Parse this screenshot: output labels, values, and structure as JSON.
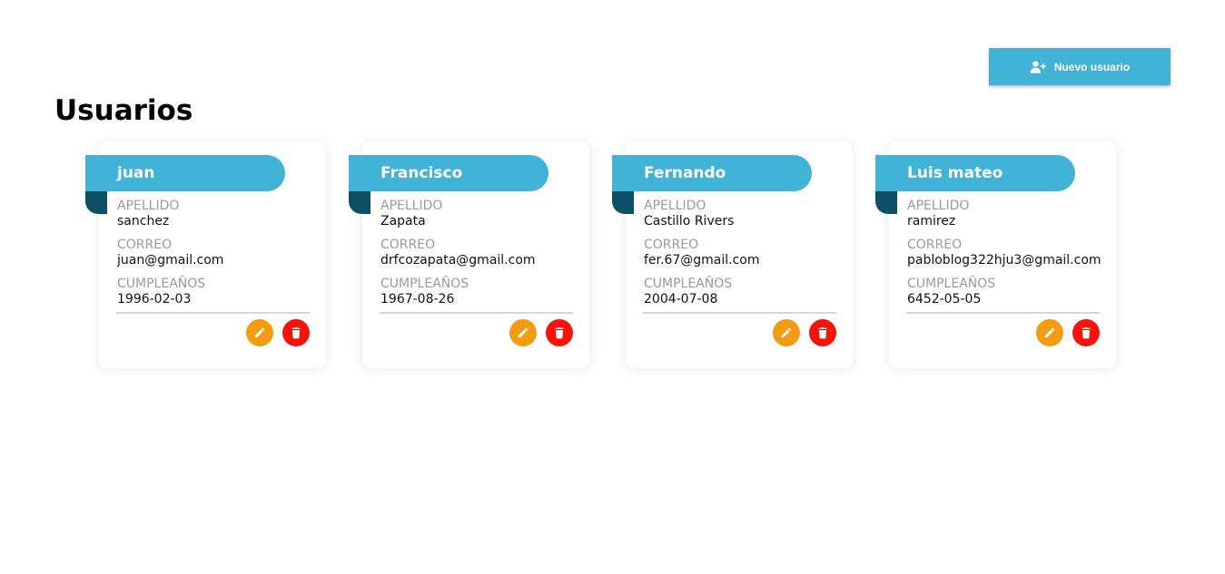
{
  "header": {
    "title": "Usuarios",
    "new_user_label": "Nuevo usuario"
  },
  "colors": {
    "accent": "#40b3d6",
    "ribbon_fold": "#0e4f66",
    "edit": "#f39c12",
    "delete": "#f5140a"
  },
  "icons": {
    "new_user": "user-plus-icon",
    "edit": "pencil-icon",
    "delete": "trash-icon"
  },
  "labels": {
    "apellido": "APELLIDO",
    "correo": "CORREO",
    "cumpleanos": "CUMPLEAÑOS"
  },
  "users": [
    {
      "name": "juan",
      "apellido": "sanchez",
      "correo": "juan@gmail.com",
      "cumpleanos": "1996-02-03"
    },
    {
      "name": "Francisco",
      "apellido": "Zapata",
      "correo": "drfcozapata@gmail.com",
      "cumpleanos": "1967-08-26"
    },
    {
      "name": "Fernando",
      "apellido": "Castillo Rivers",
      "correo": "fer.67@gmail.com",
      "cumpleanos": "2004-07-08"
    },
    {
      "name": "Luis mateo",
      "apellido": "ramirez",
      "correo": "pabloblog322hju3@gmail.com",
      "cumpleanos": "6452-05-05"
    }
  ]
}
